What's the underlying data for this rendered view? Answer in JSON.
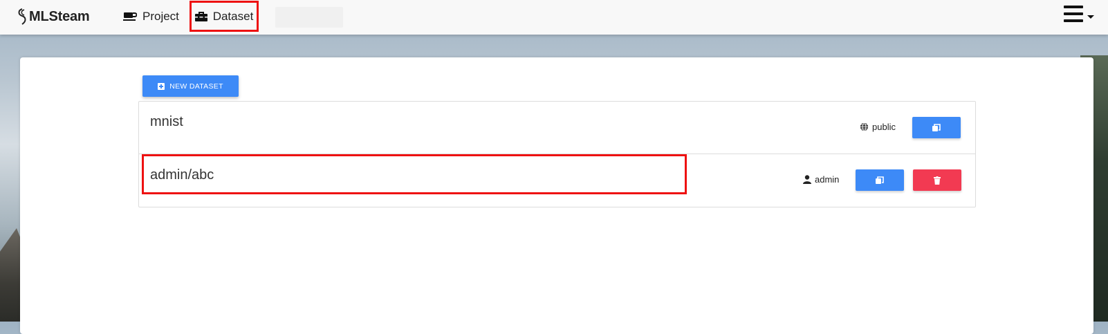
{
  "app": {
    "brand": "MLSteam"
  },
  "nav": [
    {
      "label": "Project",
      "icon": "coffee-cup-icon"
    },
    {
      "label": "Dataset",
      "icon": "toolbox-icon",
      "active": true
    }
  ],
  "menu": {
    "icon": "hamburger-menu-icon"
  },
  "toolbar": {
    "new_dataset_label": "NEW DATASET"
  },
  "datasets": [
    {
      "name": "mnist",
      "owner": "public",
      "owner_icon": "globe-icon",
      "actions": [
        "copy"
      ]
    },
    {
      "name": "admin/abc",
      "owner": "admin",
      "owner_icon": "user-icon",
      "actions": [
        "copy",
        "delete"
      ]
    }
  ],
  "colors": {
    "primary": "#3d8af7",
    "danger": "#f23a52",
    "highlight": "#e11111"
  }
}
